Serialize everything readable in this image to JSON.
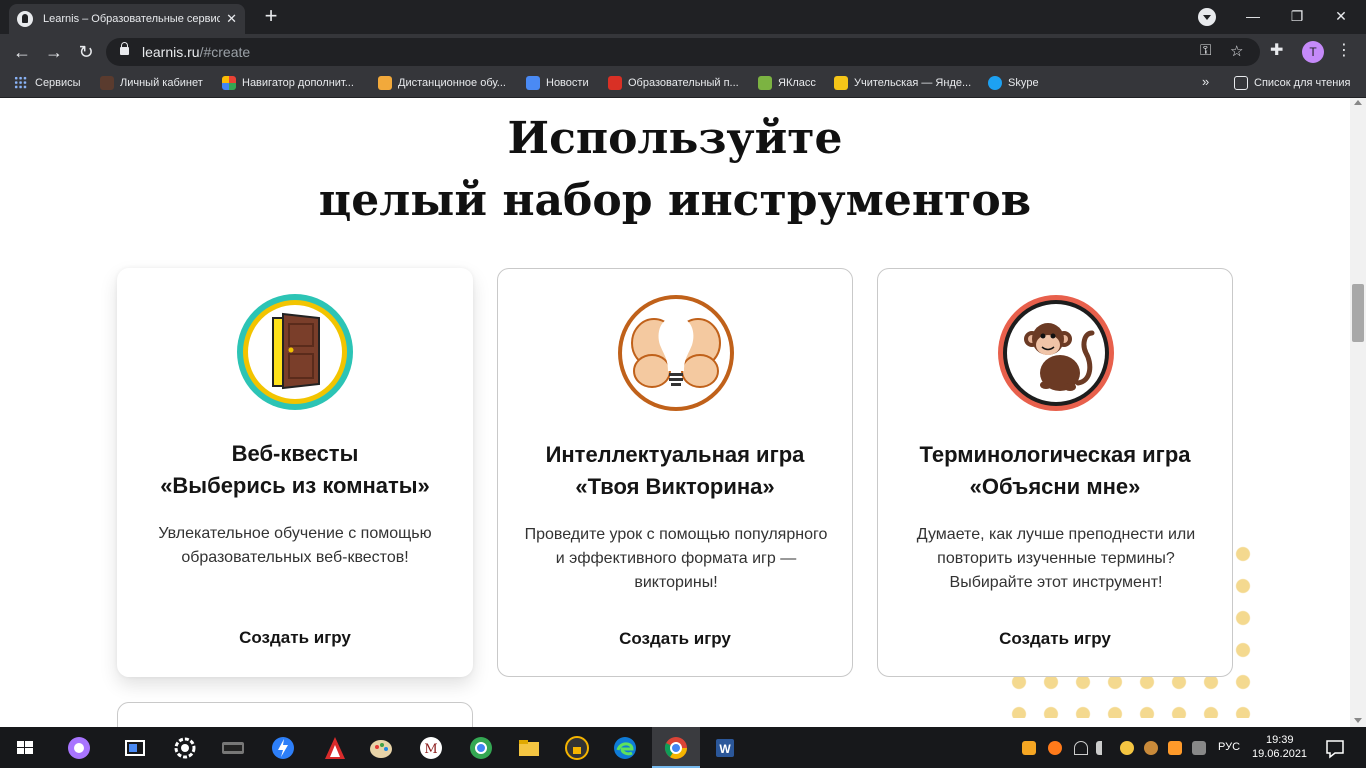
{
  "browser": {
    "tab_title": "Learnis – Образовательные сервисы",
    "tab_close": "✕",
    "new_tab": "+",
    "url_host": "learnis.ru",
    "url_path": "/#create",
    "minimize": "—",
    "maximize": "❐",
    "close": "✕",
    "back": "←",
    "forward": "→",
    "reload": "↻",
    "key_icon": "⚿",
    "star_icon": "☆",
    "puzzle_icon": "✚",
    "profile_initial": "T",
    "menu_icon": "⋮"
  },
  "bookmarks": {
    "items": [
      {
        "label": "Сервисы",
        "color": "#8ab4f8"
      },
      {
        "label": "Личный кабинет",
        "color": "#5a3b2e"
      },
      {
        "label": "Навигатор дополнит...",
        "color": "#e94235"
      },
      {
        "label": "Дистанционное обу...",
        "color": "#f2a93b"
      },
      {
        "label": "Новости",
        "color": "#4a8af4"
      },
      {
        "label": "Образовательный п...",
        "color": "#d93025"
      },
      {
        "label": "ЯКласс",
        "color": "#7cb342"
      },
      {
        "label": "Учительская — Яндe...",
        "color": "#f5c518"
      },
      {
        "label": "Skype",
        "color": "#1da1f2"
      }
    ],
    "more": "»",
    "reading_list": "Список для чтения"
  },
  "page": {
    "heading_line1": "Используйте",
    "heading_line2": "целый набор инструментов",
    "cards": [
      {
        "title_line1": "Веб-квесты",
        "title_line2": "«Выберись из комнаты»",
        "description": "Увлекательное обучение с помощью образовательных веб-квестов!",
        "button": "Создать игру",
        "icon": "door-icon",
        "ring_color": "#2cc4b5"
      },
      {
        "title_line1": "Интеллектуальная игра",
        "title_line2": "«Твоя Викторина»",
        "description": "Проведите урок с помощью популярного и эффективного формата игр — викторины!",
        "button": "Создать игру",
        "icon": "brain-bulb-icon",
        "ring_color": "#c0611a"
      },
      {
        "title_line1": "Терминологическая игра",
        "title_line2": "«Объясни мне»",
        "description": "Думаете, как лучше преподнести или повторить изученные термины? Выбирайте этот инструмент!",
        "button": "Создать игру",
        "icon": "monkey-icon",
        "ring_color": "#e8604c"
      }
    ]
  },
  "taskbar": {
    "language": "РУС",
    "time": "19:39",
    "date": "19.06.2021"
  }
}
